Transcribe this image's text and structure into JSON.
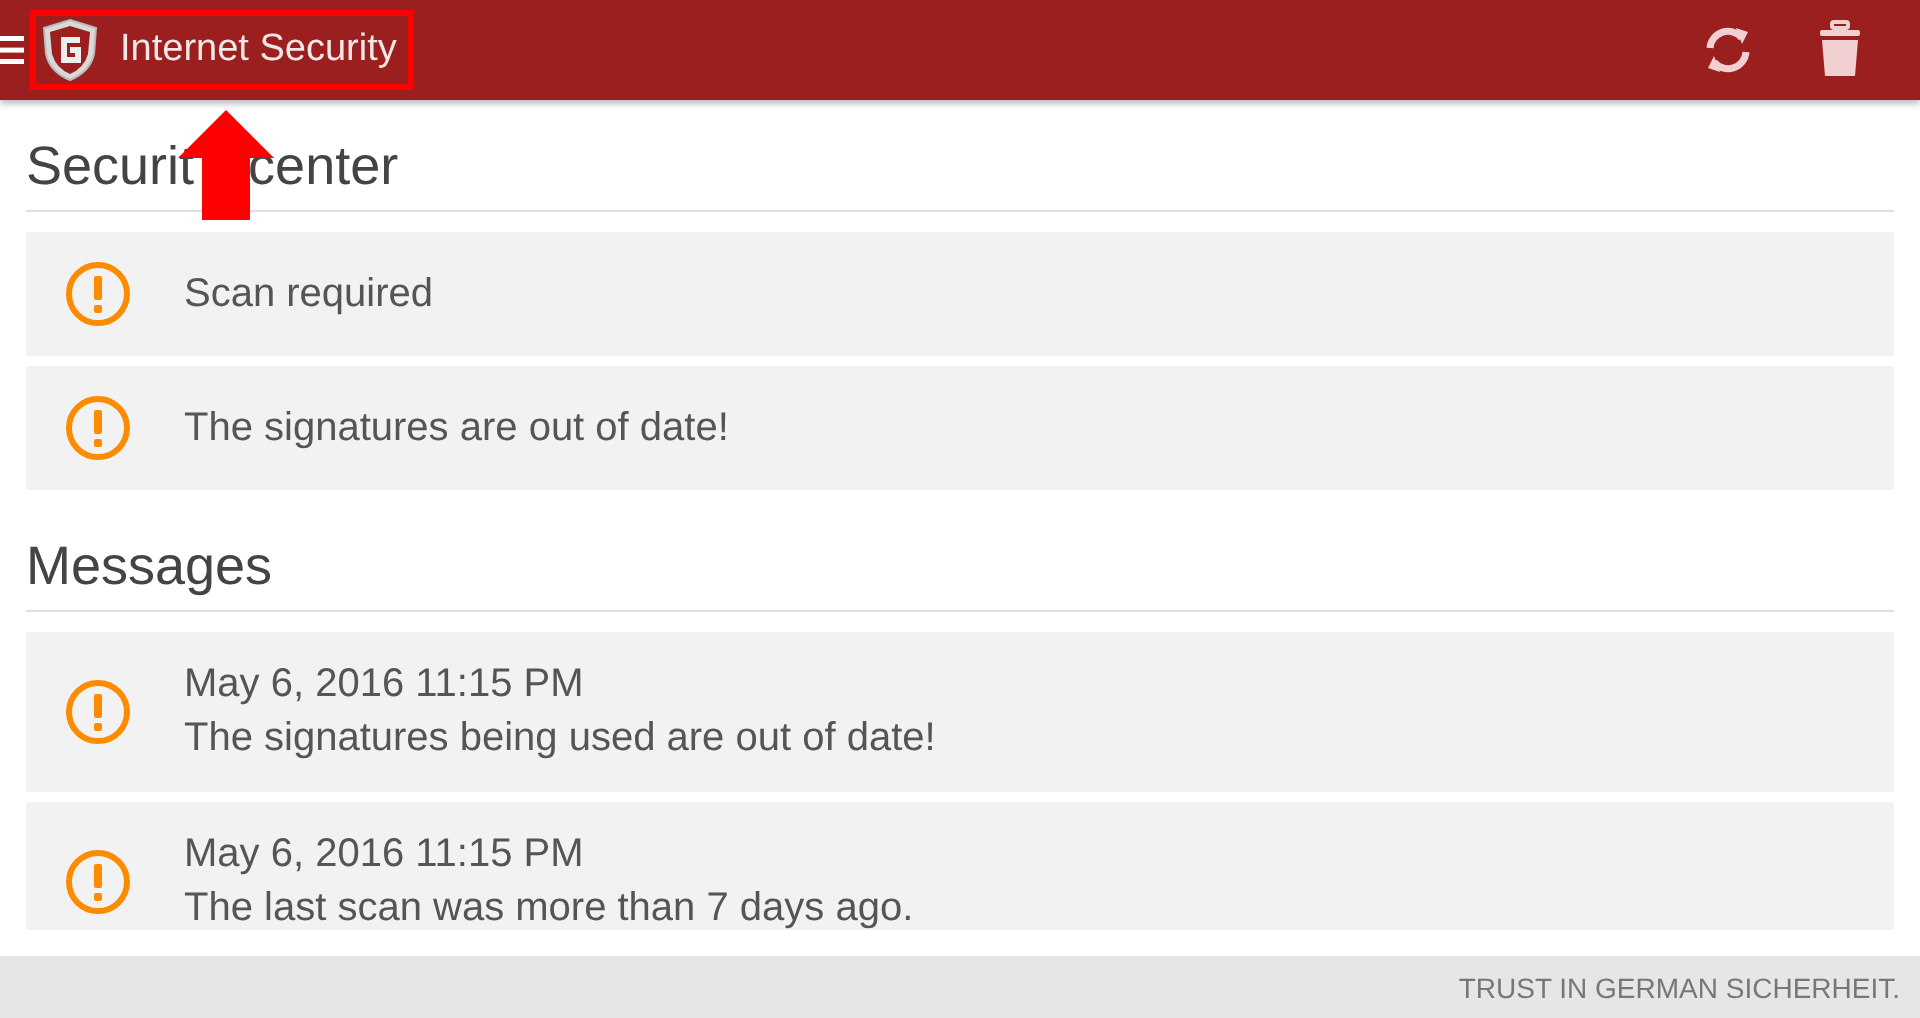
{
  "app_bar": {
    "title": "Internet Security"
  },
  "security_center": {
    "heading_parts": [
      "Securit",
      "center"
    ],
    "items": [
      {
        "text": "Scan required"
      },
      {
        "text": "The signatures are out of date!"
      }
    ]
  },
  "messages": {
    "heading": "Messages",
    "items": [
      {
        "date": "May 6, 2016 11:15 PM",
        "text": "The signatures being used are out of date!"
      },
      {
        "date": "May 6, 2016 11:15 PM",
        "text": "The last scan was more than 7 days ago."
      }
    ]
  },
  "footer": "TRUST IN GERMAN SICHERHEIT."
}
